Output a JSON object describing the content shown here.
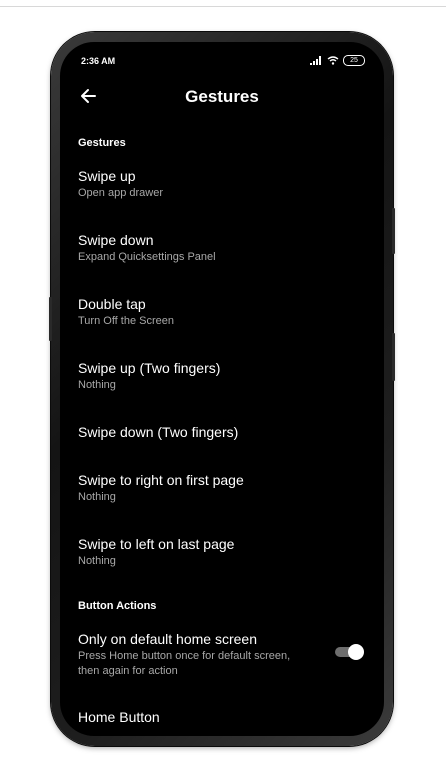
{
  "status_bar": {
    "time": "2:36 AM",
    "battery": "25",
    "icons": [
      "signal-icon",
      "wifi-icon",
      "battery-icon"
    ]
  },
  "header": {
    "title": "Gestures",
    "back_icon": "arrow-left-icon"
  },
  "sections": {
    "gestures": "Gestures",
    "button_actions": "Button Actions"
  },
  "gestures": [
    {
      "title": "Swipe up",
      "subtitle": "Open app drawer"
    },
    {
      "title": "Swipe down",
      "subtitle": "Expand Quicksettings Panel"
    },
    {
      "title": "Double tap",
      "subtitle": "Turn Off the Screen"
    },
    {
      "title": "Swipe up (Two fingers)",
      "subtitle": "Nothing"
    },
    {
      "title": "Swipe down (Two fingers)",
      "subtitle": ""
    },
    {
      "title": "Swipe to right on first page",
      "subtitle": "Nothing"
    },
    {
      "title": "Swipe to left on last page",
      "subtitle": "Nothing"
    }
  ],
  "button_actions": {
    "default_home": {
      "title": "Only on default home screen",
      "subtitle": "Press Home button once for default screen, then again for action",
      "enabled": true
    },
    "home_button": {
      "title": "Home Button"
    }
  },
  "colors": {
    "background": "#000000",
    "text_primary": "#ffffff",
    "text_secondary": "#a8a8a8",
    "toggle_track": "#6e6e6e"
  }
}
